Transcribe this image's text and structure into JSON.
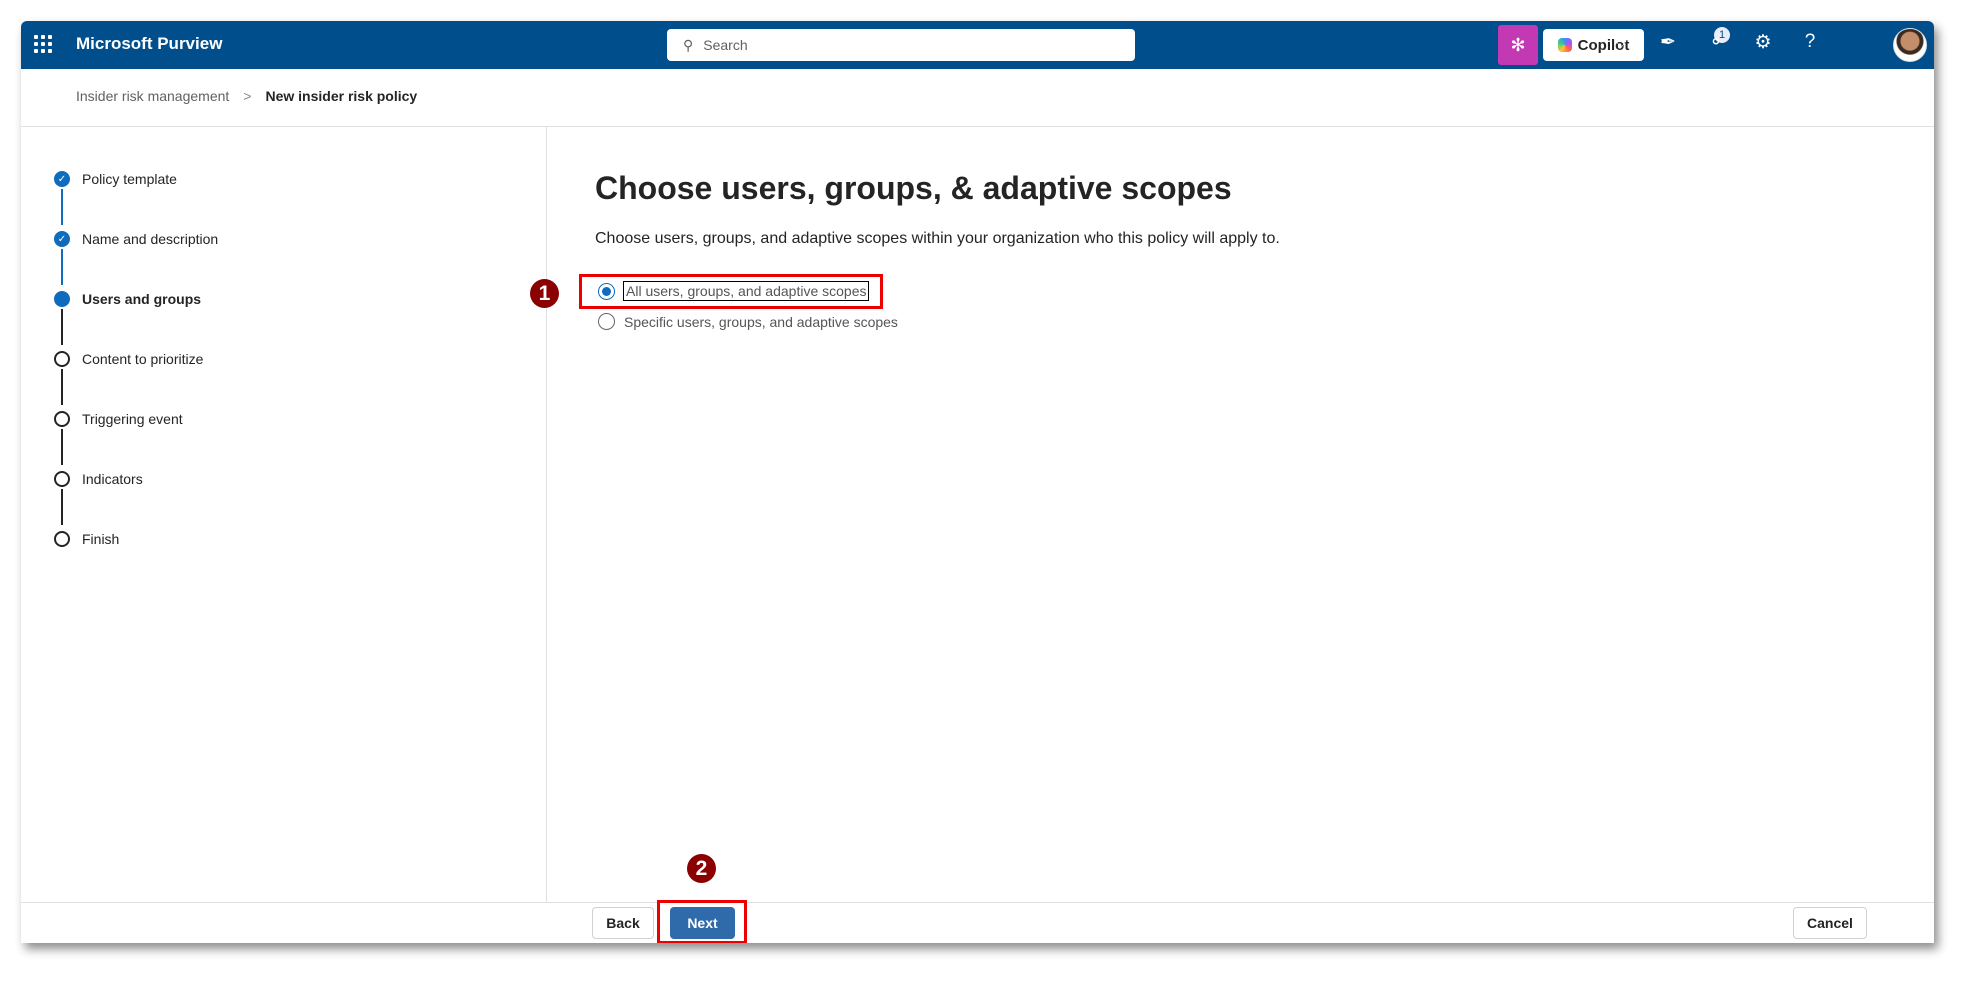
{
  "header": {
    "app_title": "Microsoft Purview",
    "search_placeholder": "Search",
    "copilot_label": "Copilot",
    "notification_badge": "1",
    "help": "?"
  },
  "breadcrumb": {
    "parent": "Insider risk management",
    "separator": ">",
    "current": "New insider risk policy"
  },
  "steps": [
    {
      "label": "Policy template",
      "status": "done"
    },
    {
      "label": "Name and description",
      "status": "done"
    },
    {
      "label": "Users and groups",
      "status": "current"
    },
    {
      "label": "Content to prioritize",
      "status": "pending"
    },
    {
      "label": "Triggering event",
      "status": "pending"
    },
    {
      "label": "Indicators",
      "status": "pending"
    },
    {
      "label": "Finish",
      "status": "pending"
    }
  ],
  "main": {
    "title": "Choose users, groups, & adaptive scopes",
    "description": "Choose users, groups, and adaptive scopes within your organization who this policy will apply to.",
    "options": [
      {
        "label": "All users, groups, and adaptive scopes",
        "selected": true
      },
      {
        "label": "Specific users, groups, and adaptive scopes",
        "selected": false
      }
    ]
  },
  "annotations": {
    "one": "1",
    "two": "2"
  },
  "footer": {
    "back": "Back",
    "next": "Next",
    "cancel": "Cancel"
  },
  "colors": {
    "header": "#004e8c",
    "accent": "#0f6cbd",
    "annotation": "#8b0000",
    "highlight": "#e00000"
  }
}
